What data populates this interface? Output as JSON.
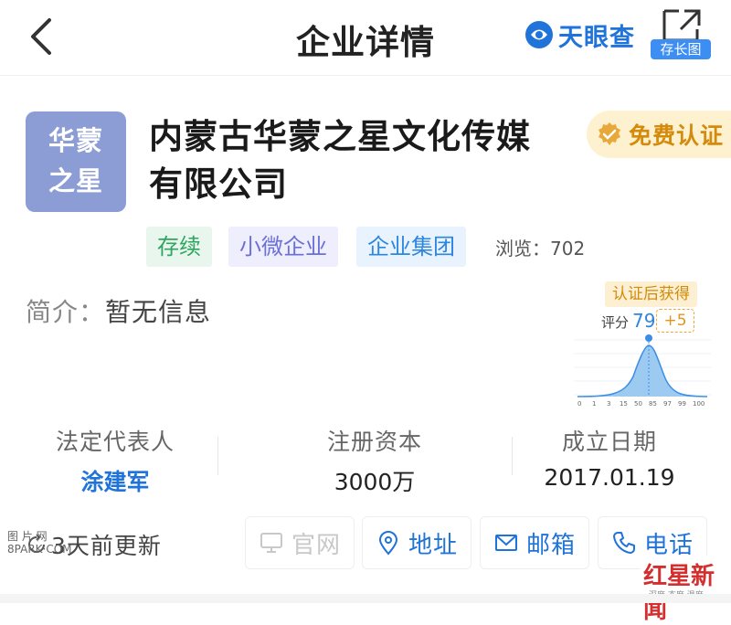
{
  "header": {
    "title": "企业详情",
    "brand": "天眼查",
    "share_label": "存长图"
  },
  "company": {
    "logo_text": [
      "华蒙",
      "之星"
    ],
    "name_lines": [
      "内蒙古华蒙之星文化传媒",
      "有限公司"
    ],
    "certify_label": "免费认证",
    "tags": [
      "存续",
      "小微企业",
      "企业集团"
    ],
    "views_label": "浏览：702",
    "intro_label": "简介：",
    "intro_value": "暂无信息"
  },
  "score_widget": {
    "badge": "认证后获得",
    "score_label": "评分",
    "score_value": "79",
    "bonus": "+5",
    "axis_ticks": [
      "0",
      "1",
      "3",
      "15",
      "50",
      "85",
      "97",
      "99",
      "100"
    ]
  },
  "stats": [
    {
      "label": "法定代表人",
      "value": "涂建军"
    },
    {
      "label": "注册资本",
      "value": "3000万"
    },
    {
      "label": "成立日期",
      "value": "2017.01.19"
    }
  ],
  "footer": {
    "update_text": "3天前更新",
    "buttons": [
      {
        "label": "官网",
        "icon": "monitor-icon",
        "enabled": false
      },
      {
        "label": "地址",
        "icon": "location-pin-icon",
        "enabled": true
      },
      {
        "label": "邮箱",
        "icon": "mail-icon",
        "enabled": true
      },
      {
        "label": "电话",
        "icon": "phone-icon",
        "enabled": true
      }
    ]
  },
  "watermarks": {
    "left_top": "图 片 网",
    "left_bottom": "8PARK·COM",
    "right_big": "红星新闻",
    "right_small": "深度 态度 温度"
  },
  "colors": {
    "accent_blue": "#1f73d9",
    "logo_bg": "#8b9dd4",
    "certify_bg": "#fdf1cf",
    "certify_text": "#d48a0b"
  }
}
